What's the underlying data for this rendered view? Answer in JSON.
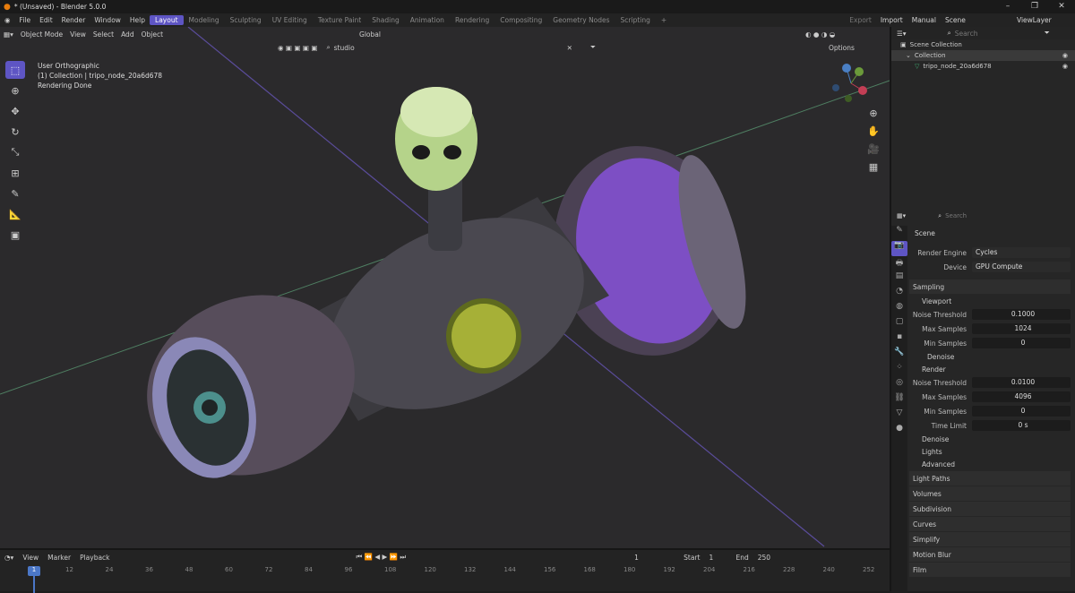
{
  "title": "* (Unsaved) - Blender 5.0.0",
  "menu": [
    "File",
    "Edit",
    "Render",
    "Window",
    "Help"
  ],
  "workspaces": [
    "Layout",
    "Modeling",
    "Sculpting",
    "UV Editing",
    "Texture Paint",
    "Shading",
    "Animation",
    "Rendering",
    "Compositing",
    "Geometry Nodes",
    "Scripting"
  ],
  "topright": {
    "export": "Export",
    "import": "Import",
    "manual": "Manual",
    "scene": "Scene",
    "viewlayer": "ViewLayer"
  },
  "viewport": {
    "mode": "Object Mode",
    "menus": [
      "View",
      "Select",
      "Add",
      "Object"
    ],
    "orientation": "Global",
    "hdri": "studio",
    "options": "Options",
    "overlay": {
      "view": "User Orthographic",
      "collection": "(1) Collection | tripo_node_20a6d678",
      "status": "Rendering Done"
    }
  },
  "outliner": {
    "root": "Scene Collection",
    "collection": "Collection",
    "object": "tripo_node_20a6d678"
  },
  "props": {
    "search_placeholder": "Search",
    "scene": "Scene",
    "engine_label": "Render Engine",
    "engine": "Cycles",
    "device_label": "Device",
    "device": "GPU Compute",
    "sampling": "Sampling",
    "viewport": "Viewport",
    "noise_label": "Noise Threshold",
    "vp_noise": "0.1000",
    "max_label": "Max Samples",
    "vp_max": "1024",
    "min_label": "Min Samples",
    "vp_min": "0",
    "denoise": "Denoise",
    "render": "Render",
    "r_noise": "0.0100",
    "r_max": "4096",
    "r_min": "0",
    "time_label": "Time Limit",
    "r_time": "0 s",
    "lights": "Lights",
    "advanced": "Advanced",
    "sections": [
      "Light Paths",
      "Volumes",
      "Subdivision",
      "Curves",
      "Simplify",
      "Motion Blur",
      "Film"
    ]
  },
  "timeline": {
    "menus": [
      "View",
      "Marker",
      "Playback"
    ],
    "current": "1",
    "start_label": "Start",
    "start": "1",
    "end_label": "End",
    "end": "250",
    "ticks": [
      "12",
      "24",
      "36",
      "48",
      "60",
      "72",
      "84",
      "96",
      "108",
      "120",
      "132",
      "144",
      "156",
      "168",
      "180",
      "192",
      "204",
      "216",
      "228",
      "240",
      "252"
    ],
    "head": "1"
  }
}
